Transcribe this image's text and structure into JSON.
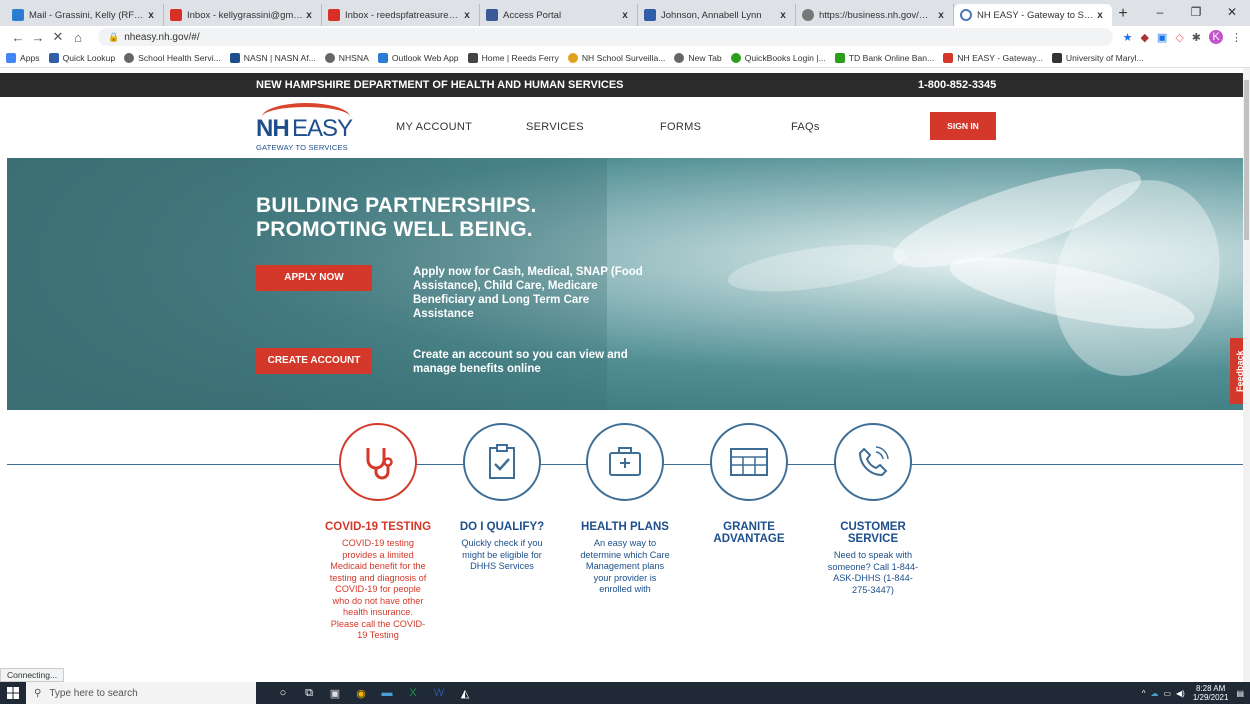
{
  "browser": {
    "tabs": [
      {
        "title": "Mail - Grassini, Kelly (RFS) - Outl",
        "color": "#2b7cd3"
      },
      {
        "title": "Inbox - kellygrassini@gmail.com",
        "color": "#d93025"
      },
      {
        "title": "Inbox - reedspfatreasurer@gmai",
        "color": "#d93025"
      },
      {
        "title": "Access Portal",
        "color": "#3b5998"
      },
      {
        "title": "Johnson, Annabell Lynn",
        "color": "#2e5fa8"
      },
      {
        "title": "https://business.nh.gov/DOS_CC",
        "color": "#777777"
      },
      {
        "title": "NH EASY - Gateway to Services",
        "color": "#4a78b8"
      }
    ],
    "close_glyph": "x",
    "new_tab_glyph": "+",
    "window_controls": {
      "minimize": "–",
      "restore": "❐",
      "close": "✕"
    },
    "nav": {
      "back": "←",
      "forward": "→",
      "stop": "✕",
      "home": "⌂"
    },
    "url": "nheasy.nh.gov/#/",
    "profile_initial": "K",
    "bookmarks": [
      {
        "label": "Apps",
        "color": "#4285f4"
      },
      {
        "label": "Quick Lookup",
        "color": "#2e5fa8"
      },
      {
        "label": "School Health Servi...",
        "color": "#666666"
      },
      {
        "label": "NASN | NASN Af...",
        "color": "#1c4f8c"
      },
      {
        "label": "NHSNA",
        "color": "#666666"
      },
      {
        "label": "Outlook Web App",
        "color": "#2b7cd3"
      },
      {
        "label": "Home | Reeds Ferry",
        "color": "#444444"
      },
      {
        "label": "NH School Surveilla...",
        "color": "#e0a020"
      },
      {
        "label": "New Tab",
        "color": "#666666"
      },
      {
        "label": "QuickBooks Login |...",
        "color": "#2ca01c"
      },
      {
        "label": "TD Bank Online Ban...",
        "color": "#2ca01c"
      },
      {
        "label": "NH EASY - Gateway...",
        "color": "#d4382a"
      },
      {
        "label": "University of Maryl...",
        "color": "#333333"
      }
    ],
    "status_text": "Connecting..."
  },
  "site": {
    "department": "NEW HAMPSHIRE DEPARTMENT OF HEALTH AND HUMAN SERVICES",
    "phone": "1-800-852-3345",
    "logo": {
      "nh": "NH",
      "easy": "EASY",
      "tagline": "GATEWAY TO SERVICES"
    },
    "nav": {
      "my_account": "MY ACCOUNT",
      "services": "SERVICES",
      "forms": "FORMS",
      "faqs": "FAQs",
      "sign_in": "SIGN IN"
    },
    "hero": {
      "line1": "BUILDING PARTNERSHIPS.",
      "line2": "PROMOTING WELL BEING.",
      "apply_button": "APPLY NOW",
      "apply_text": "Apply now for Cash, Medical, SNAP (Food Assistance), Child Care, Medicare Beneficiary and Long Term Care Assistance",
      "create_button": "CREATE ACCOUNT",
      "create_text": "Create an account so you can view and manage benefits online"
    },
    "feedback": "Feedback",
    "features": [
      {
        "title": "COVID-19 TESTING",
        "desc": "COVID-19 testing provides a limited Medicaid benefit for the testing and diagnosis of COVID-19 for people who do not have other health insurance. Please call the COVID-19 Testing"
      },
      {
        "title": "DO I QUALIFY?",
        "desc": "Quickly check if you might be eligible for DHHS Services"
      },
      {
        "title": "HEALTH PLANS",
        "desc": "An easy way to determine which Care Management plans your provider is enrolled with"
      },
      {
        "title": "GRANITE ADVANTAGE",
        "desc": ""
      },
      {
        "title": "CUSTOMER SERVICE",
        "desc": "Need to speak with someone? Call 1-844-ASK-DHHS (1-844-275-3447)"
      }
    ],
    "colors": {
      "red": "#d4382a",
      "blue": "#1c4f8c",
      "dark": "#2b2b2b"
    }
  },
  "taskbar": {
    "search_placeholder": "Type here to search",
    "time": "8:28 AM",
    "date": "1/29/2021"
  }
}
